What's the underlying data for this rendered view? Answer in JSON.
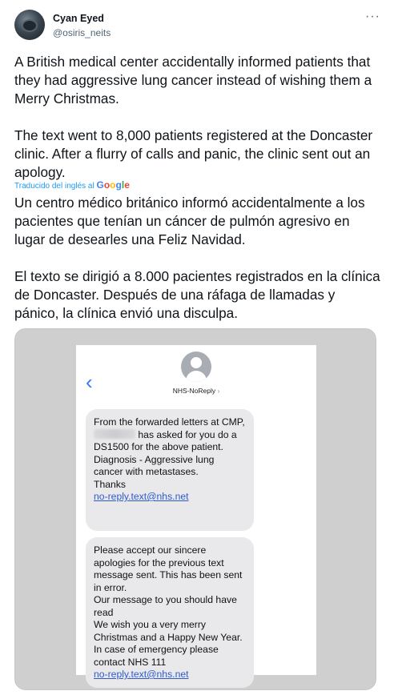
{
  "author": {
    "name": "Cyan Eyed",
    "handle": "@osiris_neits"
  },
  "more_label": "···",
  "tweet": {
    "original_paragraphs": [
      "A British medical center accidentally informed patients that they had aggressive lung cancer instead of wishing them a Merry Christmas.",
      "The text went to 8,000 patients registered at the Doncaster clinic. After a flurry of calls and panic, the clinic sent out an apology."
    ],
    "translated_by_label": "Traducido del inglés al",
    "translated_by_brand": "Google",
    "translated_paragraphs": [
      "Un centro médico británico informó accidentalmente a los pacientes que tenían un cáncer de pulmón agresivo en lugar de desearles una Feliz Navidad.",
      "El texto se dirigió a 8.000 pacientes registrados en la clínica de Doncaster. Después de una ráfaga de llamadas y pánico, la clínica envió una disculpa."
    ]
  },
  "sms": {
    "contact_name": "NHS-NoReply",
    "contact_chevron": "›",
    "back_icon": "‹",
    "message1": {
      "line_before_blur": "From the forwarded letters at CMP, ",
      "line_after_blur": " has asked for you do a DS1500 for the above patient.  Diagnosis - Aggressive lung cancer with metastases.\nThanks",
      "link": "no-reply.text@nhs.net"
    },
    "message2": {
      "text": "Please accept our sincere apologies for the previous text message sent.  This has been sent in error.\nOur message to you should have read\nWe wish you a very merry Christmas and a Happy New Year.  In case of emergency please contact NHS 111",
      "link": "no-reply.text@nhs.net"
    }
  },
  "colors": {
    "link_blue": "#1d9bf0",
    "ios_blue": "#3478f6",
    "bubble_gray": "#e9e9eb"
  }
}
